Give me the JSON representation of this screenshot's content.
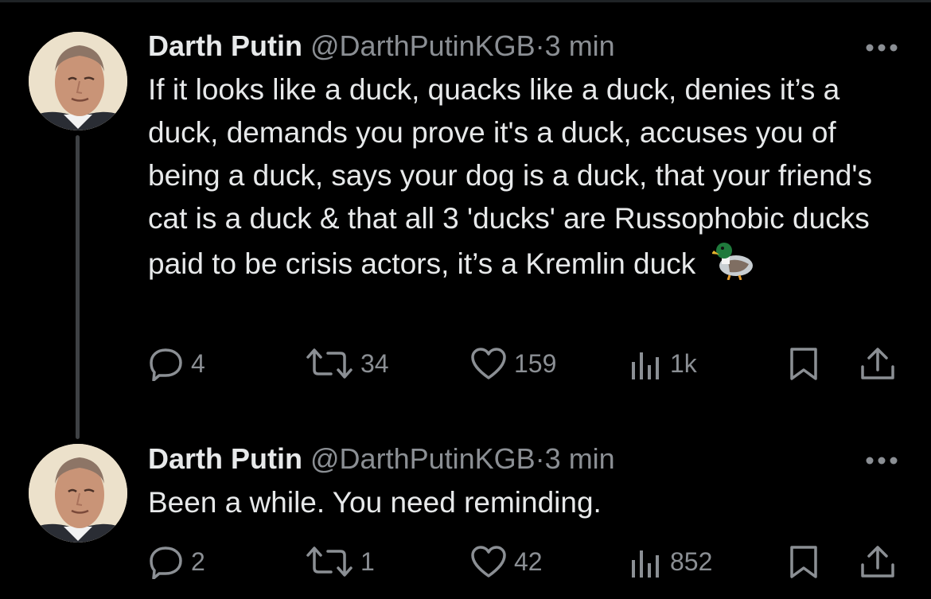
{
  "tweets": [
    {
      "author_name": "Darth Putin",
      "handle": "@DarthPutinKGB",
      "separator": "·",
      "time": "3 min",
      "text": "If it looks like a duck, quacks like a duck, denies it’s a duck, demands you prove it's a duck, accuses you of being a duck, says your dog is a duck, that your friend's cat is a duck & that all 3 'ducks' are Russophobic ducks paid to be crisis actors, it’s a Kremlin duck",
      "emoji_icon": "duck-icon",
      "replies": "4",
      "reposts": "34",
      "likes": "159",
      "views": "1k"
    },
    {
      "author_name": "Darth Putin",
      "handle": "@DarthPutinKGB",
      "separator": "·",
      "time": "3 min",
      "text": "Been a while. You need reminding.",
      "replies": "2",
      "reposts": "1",
      "likes": "42",
      "views": "852"
    }
  ],
  "icons": [
    "reply-icon",
    "repost-icon",
    "like-icon",
    "views-icon",
    "bookmark-icon",
    "share-icon",
    "more-icon"
  ],
  "colors": {
    "background": "#000000",
    "primary_text": "#e7e9ea",
    "secondary_text": "#8b8f94",
    "thread_line": "#3e4144"
  }
}
